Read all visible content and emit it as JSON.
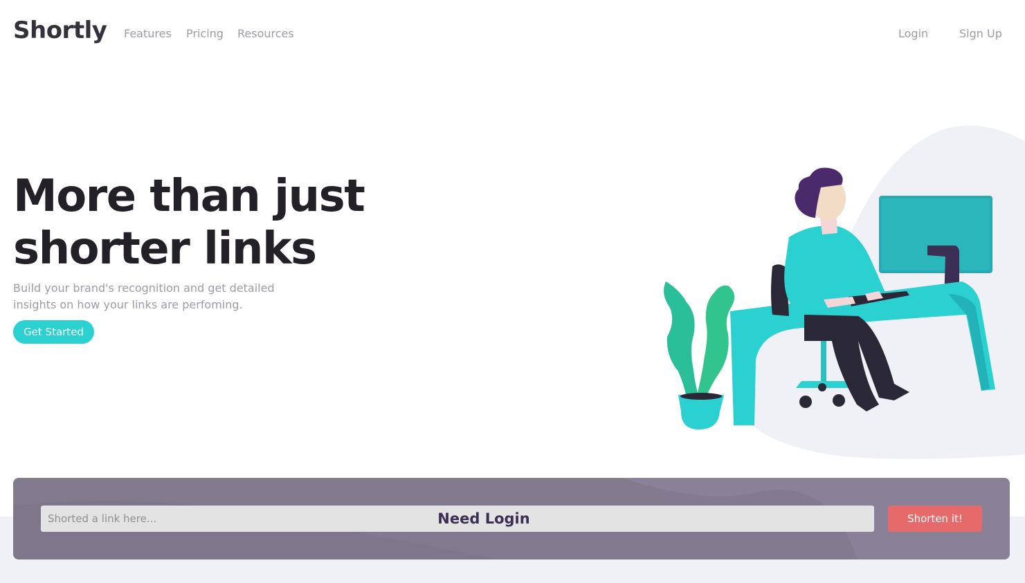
{
  "brand": {
    "logo": "Shortly",
    "accent_color": "#2bd0d0",
    "dark_violet": "#3b3054",
    "red": "#e66a6a"
  },
  "nav": {
    "features": "Features",
    "pricing": "Pricing",
    "resources": "Resources",
    "login": "Login",
    "signup": "Sign Up"
  },
  "hero": {
    "title_line1": "More than just",
    "title_line2": "shorter links",
    "subtitle_line1": "Build your brand's recognition and get detailed",
    "subtitle_line2": "insights on how your links are perfoming.",
    "cta": "Get Started",
    "illustration_icon": "person-working-illustration"
  },
  "shorten": {
    "placeholder": "Shorted a link here...",
    "overlay_message": "Need Login",
    "button": "Shorten it!"
  }
}
